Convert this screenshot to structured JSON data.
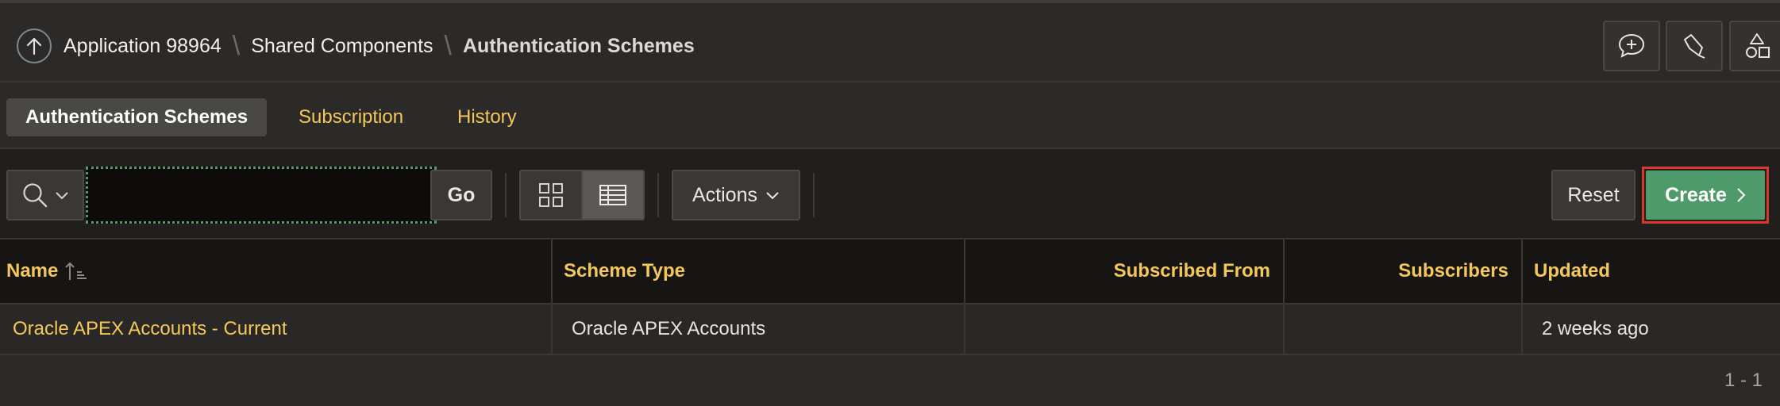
{
  "breadcrumb": {
    "items": [
      "Application 98964",
      "Shared Components"
    ],
    "current": "Authentication Schemes",
    "separator": "\\"
  },
  "header_actions": [
    "chat-add-icon",
    "flashlight-icon",
    "shapes-icon"
  ],
  "tabs": [
    {
      "label": "Authentication Schemes",
      "active": true
    },
    {
      "label": "Subscription",
      "active": false
    },
    {
      "label": "History",
      "active": false
    }
  ],
  "toolbar": {
    "search_value": "",
    "go_label": "Go",
    "actions_label": "Actions",
    "reset_label": "Reset",
    "create_label": "Create",
    "view_selected": "report"
  },
  "table": {
    "columns": [
      "Name",
      "Scheme Type",
      "Subscribed From",
      "Subscribers",
      "Updated"
    ],
    "sort": {
      "column": "Name",
      "direction": "ascending"
    },
    "rows": [
      {
        "name": "Oracle APEX Accounts - Current",
        "scheme_type": "Oracle APEX Accounts",
        "subscribed_from": "",
        "subscribers": "",
        "updated": "2 weeks ago"
      }
    ]
  },
  "pagination": "1 - 1",
  "colors": {
    "accent": "#f4c75a",
    "create_green": "#4f9a6a",
    "highlight_red": "#d9372b",
    "background": "#2c2a28"
  }
}
